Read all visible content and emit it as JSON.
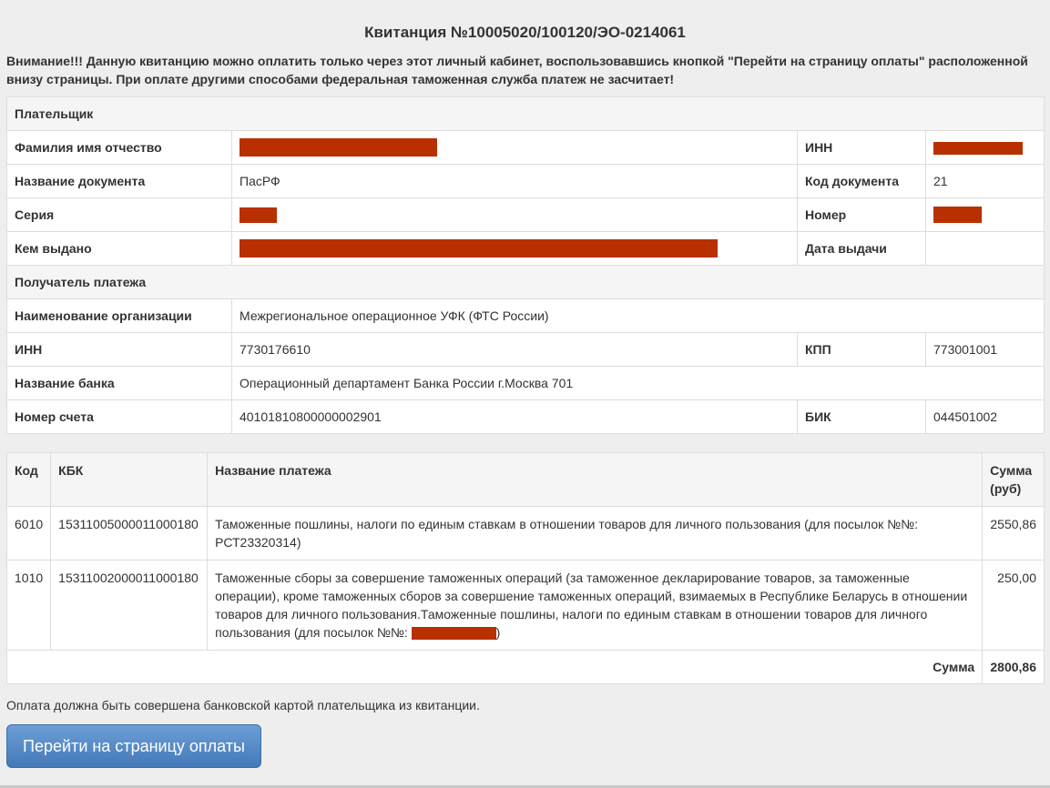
{
  "title": "Квитанция №10005020/100120/ЭО-0214061",
  "warning": "Внимание!!! Данную квитанцию можно оплатить только через этот личный кабинет, воспользовавшись кнопкой \"Перейти на страницу оплаты\" расположенной внизу страницы. При оплате другими способами федеральная таможенная служба платеж не засчитает!",
  "payer": {
    "section": "Плательщик",
    "fio_label": "Фамилия имя отчество",
    "inn_label": "ИНН",
    "doc_name_label": "Название документа",
    "doc_name": "ПасРФ",
    "doc_code_label": "Код документа",
    "doc_code": "21",
    "series_label": "Серия",
    "number_label": "Номер",
    "issued_by_label": "Кем выдано",
    "issue_date_label": "Дата выдачи"
  },
  "recipient": {
    "section": "Получатель платежа",
    "org_label": "Наименование организации",
    "org": "Межрегиональное операционное УФК (ФТС России)",
    "inn_label": "ИНН",
    "inn": "7730176610",
    "kpp_label": "КПП",
    "kpp": "773001001",
    "bank_label": "Название банка",
    "bank": "Операционный департамент Банка России г.Москва 701",
    "account_label": "Номер счета",
    "account": "40101810800000002901",
    "bik_label": "БИК",
    "bik": "044501002"
  },
  "payments": {
    "headers": [
      "Код",
      "КБК",
      "Название платежа",
      "Сумма (руб)"
    ],
    "rows": [
      {
        "code": "6010",
        "kbk": "15311005000011000180",
        "name": "Таможенные пошлины, налоги по единым ставкам в отношении товаров для личного пользования (для посылок №№: РСТ23320314)",
        "sum": "2550,86"
      },
      {
        "code": "1010",
        "kbk": "15311002000011000180",
        "name": "Таможенные сборы за совершение таможенных операций (за таможенное декларирование товаров, за таможенные операции), кроме таможенных сборов за совершение таможенных операций, взимаемых в Республике Беларусь в отношении товаров для личного пользования.Таможенные пошлины, налоги по единым ставкам в отношении товаров для личного пользования (для посылок №№: ",
        "sum": "250,00"
      }
    ],
    "total_label": "Сумма",
    "total": "2800,86"
  },
  "note": "Оплата должна быть совершена банковской картой плательщика из квитанции.",
  "pay_button": "Перейти на страницу оплаты",
  "colors": {
    "redaction": "#b83000",
    "button": "#4a7fc0"
  }
}
